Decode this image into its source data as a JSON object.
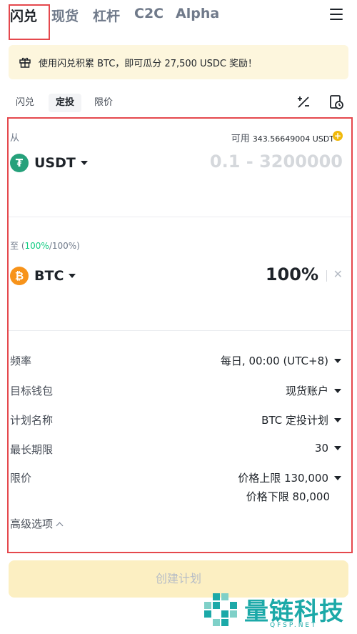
{
  "nav": {
    "tabs": [
      "闪兑",
      "现货",
      "杠杆",
      "C2C",
      "Alpha"
    ],
    "active_index": 0
  },
  "banner": {
    "text": "使用闪兑积累 BTC，即可瓜分 27,500 USDC 奖励！"
  },
  "subtabs": [
    "闪兑",
    "定投",
    "限价"
  ],
  "from": {
    "label": "从",
    "available_label": "可用",
    "available_value": "343.56649004 USDT",
    "coin": "USDT",
    "coin_icon": "tether-icon",
    "placeholder": "0.1 - 3200000"
  },
  "to": {
    "label_prefix": "至 (",
    "label_green": "100%",
    "label_suffix": "/100%)",
    "coin": "BTC",
    "coin_icon": "bitcoin-icon",
    "amount": "100%"
  },
  "fields": {
    "frequency_label": "频率",
    "frequency_value": "每日, 00:00 (UTC+8)",
    "wallet_label": "目标钱包",
    "wallet_value": "现货账户",
    "plan_name_label": "计划名称",
    "plan_name_value": "BTC 定投计划",
    "max_period_label": "最长期限",
    "max_period_value": "30",
    "limit_label": "限价",
    "limit_upper": "价格上限 130,000",
    "limit_lower": "价格下限 80,000"
  },
  "advanced_label": "高级选项",
  "create_button": "创建计划",
  "watermark": {
    "text": "量链科技",
    "sub": "QFSP.NET"
  },
  "colors": {
    "accent_yellow": "#f0b90b",
    "green": "#0ecb81",
    "highlight_red": "#e5484d",
    "tether": "#26a17b",
    "bitcoin": "#f7931a"
  }
}
